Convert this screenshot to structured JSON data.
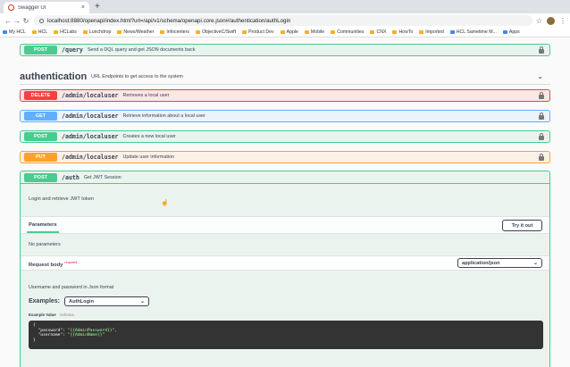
{
  "browser": {
    "tab_title": "Swagger UI",
    "tab_close": "×",
    "new_tab": "+",
    "url": "localhost:8880/openapi/index.html?url=/api/v1/schema/openapi.core.json#/authentication/authLogin",
    "bookmarks": [
      "My HCL",
      "HCL",
      "HCLabs",
      "Lunchdrop",
      "News/Weather",
      "Infocenters",
      "ObjectiveC/Swift",
      "Product Dev",
      "Apple",
      "Mobile",
      "Communities",
      "CNX",
      "HowTo",
      "Imported",
      "HCL Sametime M...",
      "Apps"
    ]
  },
  "top_op": {
    "method": "POST",
    "path": "/query",
    "summary": "Send a DQL query and get JSON documents back"
  },
  "tag": {
    "name": "authentication",
    "description": "URL Endpoints to get access to the system",
    "chevron": "⌄"
  },
  "operations": [
    {
      "method": "DELETE",
      "path": "/admin/localuser",
      "summary": "Removes a local user"
    },
    {
      "method": "GET",
      "path": "/admin/localuser",
      "summary": "Retrieve information about a local user"
    },
    {
      "method": "POST",
      "path": "/admin/localuser",
      "summary": "Creates a new local user"
    },
    {
      "method": "PUT",
      "path": "/admin/localuser",
      "summary": "Update user information"
    }
  ],
  "expanded": {
    "method": "POST",
    "path": "/auth",
    "summary": "Get JWT Session",
    "description": "Login and retrieve JWT token",
    "parameters_title": "Parameters",
    "try_it_out": "Try it out",
    "no_parameters": "No parameters",
    "request_body_title": "Request body",
    "required_label": "required",
    "content_type": "application/json",
    "body_description": "Username and password in Json format",
    "examples_label": "Examples:",
    "example_selected": "AuthLogin",
    "example_value_tab": "Example Value",
    "schema_tab": "Schema",
    "code_open": "{",
    "code_line1_key": "  \"password\": ",
    "code_line1_val": "\"{{AdminPassword}}\",",
    "code_line2_key": "  \"username\": ",
    "code_line2_val": "\"{{AdminName}}\"",
    "code_close": "}"
  }
}
